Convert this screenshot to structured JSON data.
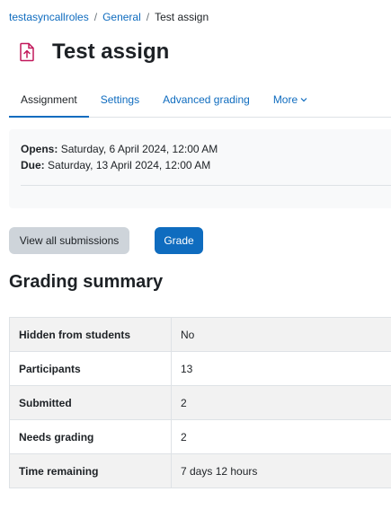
{
  "breadcrumb": {
    "course": "testasyncallroles",
    "section": "General",
    "current": "Test assign"
  },
  "header": {
    "icon": "assignment-upload-icon",
    "title": "Test assign"
  },
  "tabs": [
    {
      "label": "Assignment",
      "active": true
    },
    {
      "label": "Settings"
    },
    {
      "label": "Advanced grading"
    },
    {
      "label": "More"
    }
  ],
  "dates": {
    "opens_label": "Opens:",
    "opens_value": "Saturday, 6 April 2024, 12:00 AM",
    "due_label": "Due:",
    "due_value": "Saturday, 13 April 2024, 12:00 AM"
  },
  "actions": {
    "view_all": "View all submissions",
    "grade": "Grade"
  },
  "summary": {
    "title": "Grading summary",
    "rows": [
      {
        "label": "Hidden from students",
        "value": "No"
      },
      {
        "label": "Participants",
        "value": "13"
      },
      {
        "label": "Submitted",
        "value": "2"
      },
      {
        "label": "Needs grading",
        "value": "2"
      },
      {
        "label": "Time remaining",
        "value": "7 days 12 hours"
      }
    ]
  },
  "colors": {
    "link": "#0f6cbf",
    "icon_accent": "#c2185b",
    "primary_button": "#0f6cbf",
    "secondary_button": "#ced4da"
  }
}
